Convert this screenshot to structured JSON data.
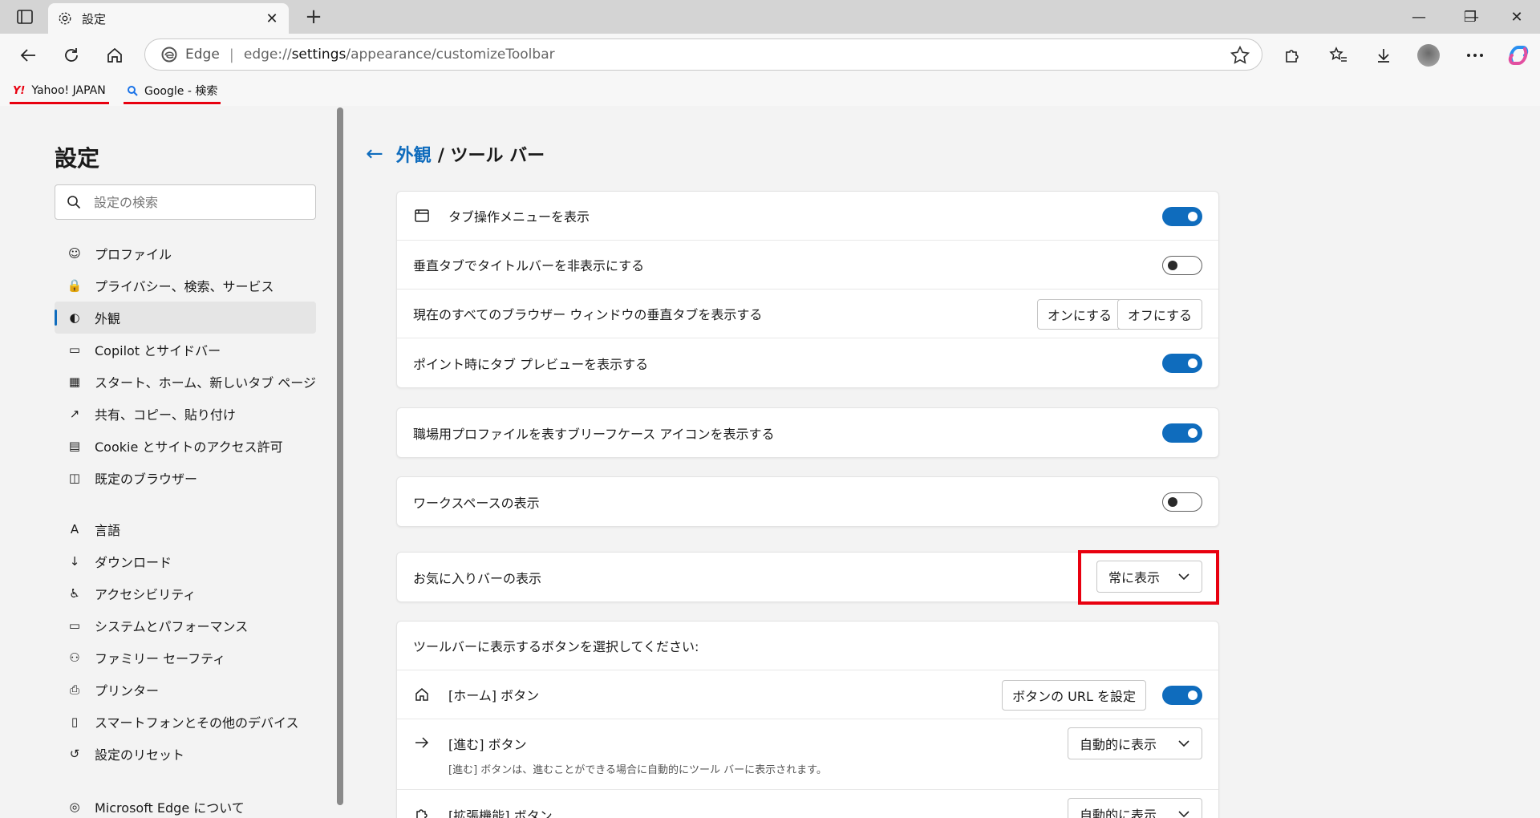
{
  "window": {
    "tab_title": "設定",
    "new_tab_symbol": "+",
    "close_symbol": "✕",
    "minimize_symbol": "—",
    "restore_symbol": "❐",
    "close_window_symbol": "✕"
  },
  "addressbar": {
    "brand": "Edge",
    "separator": "|",
    "url_prefix": "edge://",
    "url_host": "settings",
    "url_path": "/appearance/customizeToolbar"
  },
  "favorites": [
    {
      "label": "Yahoo! JAPAN",
      "icon": "yahoo-logo"
    },
    {
      "label": "Google - 検索",
      "icon": "search-icon"
    }
  ],
  "sidebar": {
    "title": "設定",
    "search_placeholder": "設定の検索",
    "items": [
      {
        "label": "プロファイル",
        "icon": "profile-icon"
      },
      {
        "label": "プライバシー、検索、サービス",
        "icon": "lock-icon"
      },
      {
        "label": "外観",
        "icon": "palette-icon",
        "active": true
      },
      {
        "label": "Copilot とサイドバー",
        "icon": "sidebar-icon"
      },
      {
        "label": "スタート、ホーム、新しいタブ ページ",
        "icon": "home-grid-icon"
      },
      {
        "label": "共有、コピー、貼り付け",
        "icon": "share-icon"
      },
      {
        "label": "Cookie とサイトのアクセス許可",
        "icon": "cookie-icon"
      },
      {
        "label": "既定のブラウザー",
        "icon": "browser-icon"
      },
      {
        "label": "言語",
        "icon": "language-icon"
      },
      {
        "label": "ダウンロード",
        "icon": "download-icon"
      },
      {
        "label": "アクセシビリティ",
        "icon": "accessibility-icon"
      },
      {
        "label": "システムとパフォーマンス",
        "icon": "laptop-icon"
      },
      {
        "label": "ファミリー セーフティ",
        "icon": "family-icon"
      },
      {
        "label": "プリンター",
        "icon": "printer-icon"
      },
      {
        "label": "スマートフォンとその他のデバイス",
        "icon": "phone-icon"
      },
      {
        "label": "設定のリセット",
        "icon": "reset-icon"
      },
      {
        "label": "Microsoft Edge について",
        "icon": "edge-logo-icon"
      }
    ]
  },
  "main": {
    "breadcrumb_link": "外観",
    "breadcrumb_rest": "/ ツール バー",
    "card1": {
      "rows": [
        {
          "label": "タブ操作メニューを表示",
          "toggle": "on"
        },
        {
          "label": "垂直タブでタイトルバーを非表示にする",
          "toggle": "off"
        },
        {
          "label": "現在のすべてのブラウザー ウィンドウの垂直タブを表示する",
          "on_btn": "オンにする",
          "off_btn": "オフにする"
        },
        {
          "label": "ポイント時にタブ プレビューを表示する",
          "toggle": "on"
        }
      ]
    },
    "card2": {
      "label": "職場用プロファイルを表すブリーフケース アイコンを表示する",
      "toggle": "on"
    },
    "card3": {
      "label": "ワークスペースの表示",
      "toggle": "off"
    },
    "card4": {
      "label": "お気に入りバーの表示",
      "select_value": "常に表示"
    },
    "card5": {
      "heading": "ツールバーに表示するボタンを選択してください:",
      "home_label": "[ホーム] ボタン",
      "home_url_btn": "ボタンの URL を設定",
      "home_toggle": "on",
      "forward_label": "[進む] ボタン",
      "forward_select": "自動的に表示",
      "forward_desc": "[進む] ボタンは、進むことができる場合に自動的にツール バーに表示されます。",
      "extensions_label": "[拡張機能] ボタン",
      "extensions_select": "自動的に表示"
    }
  },
  "colors": {
    "accent": "#0f6cbd",
    "highlight": "#e8000f"
  }
}
